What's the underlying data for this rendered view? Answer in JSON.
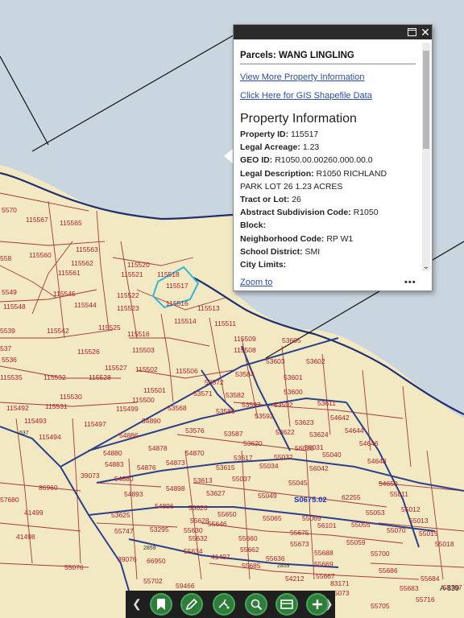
{
  "popup": {
    "controls": {
      "maximize_icon": "maximize-icon",
      "close_label": "✕"
    },
    "title": "Parcels: WANG LINGLING",
    "links": {
      "view_more": "View More Property Information",
      "shapefile": "Click Here for GIS Shapefile Data"
    },
    "section_title": "Property Information",
    "fields": [
      {
        "label": "Property ID:",
        "value": "115517"
      },
      {
        "label": "Legal Acreage:",
        "value": "1.23"
      },
      {
        "label": "GEO ID:",
        "value": "R1050.00.00260.000.00.0"
      },
      {
        "label": "Legal Description:",
        "value": "R1050 RICHLAND"
      },
      {
        "label": "",
        "value": "PARK LOT 26 1.23 ACRES"
      },
      {
        "label": "Tract or Lot:",
        "value": "26"
      },
      {
        "label": "Abstract Subdivision Code:",
        "value": "R1050"
      },
      {
        "label": "Block:",
        "value": ""
      },
      {
        "label": "Neighborhood Code:",
        "value": "RP W1"
      },
      {
        "label": "School District:",
        "value": "SMI"
      },
      {
        "label": "City Limits:",
        "value": ""
      }
    ],
    "footer": {
      "zoom": "Zoom to",
      "more": "•••"
    }
  },
  "map": {
    "colors": {
      "land": "#f2e9c3",
      "water": "#c9d6e0",
      "boundary": "#1f2f6e",
      "parcel_line": "#a5383a",
      "label": "#b0202a",
      "selected": "#2fb6d8",
      "road": "#2c3f8a"
    },
    "road_labels": [
      "637",
      "2859",
      "2859",
      "A-839"
    ],
    "highlight_label": "S0675.02",
    "parcel_labels": [
      {
        "t": "115567"
      },
      {
        "t": "115565"
      },
      {
        "t": "5570"
      },
      {
        "t": "115563"
      },
      {
        "t": "558"
      },
      {
        "t": "115560"
      },
      {
        "t": "115562"
      },
      {
        "t": "115561"
      },
      {
        "t": "115520"
      },
      {
        "t": "115521"
      },
      {
        "t": "115518"
      },
      {
        "t": "115522"
      },
      {
        "t": "115517"
      },
      {
        "t": "5549"
      },
      {
        "t": "115545"
      },
      {
        "t": "115548"
      },
      {
        "t": "115544"
      },
      {
        "t": "115523"
      },
      {
        "t": "115516"
      },
      {
        "t": "115513"
      },
      {
        "t": "115514"
      },
      {
        "t": "115511"
      },
      {
        "t": "5539"
      },
      {
        "t": "115542"
      },
      {
        "t": "115525"
      },
      {
        "t": "115516"
      },
      {
        "t": "537"
      },
      {
        "t": "115526"
      },
      {
        "t": "115503"
      },
      {
        "t": "115509"
      },
      {
        "t": "115508"
      },
      {
        "t": "53605"
      },
      {
        "t": "5536"
      },
      {
        "t": "115527"
      },
      {
        "t": "115502"
      },
      {
        "t": "115506"
      },
      {
        "t": "53584"
      },
      {
        "t": "53603"
      },
      {
        "t": "53602"
      },
      {
        "t": "115535"
      },
      {
        "t": "115532"
      },
      {
        "t": "115528"
      },
      {
        "t": "53572"
      },
      {
        "t": "53601"
      },
      {
        "t": "115501"
      },
      {
        "t": "53571"
      },
      {
        "t": "53582"
      },
      {
        "t": "53600"
      },
      {
        "t": "115530"
      },
      {
        "t": "115500"
      },
      {
        "t": "53597"
      },
      {
        "t": "115492"
      },
      {
        "t": "115531"
      },
      {
        "t": "115499"
      },
      {
        "t": "53568"
      },
      {
        "t": "53592"
      },
      {
        "t": "53611"
      },
      {
        "t": "115493"
      },
      {
        "t": "115497"
      },
      {
        "t": "54890"
      },
      {
        "t": "53586"
      },
      {
        "t": "53592"
      },
      {
        "t": "53623"
      },
      {
        "t": "54642"
      },
      {
        "t": "115494"
      },
      {
        "t": "53576"
      },
      {
        "t": "53587"
      },
      {
        "t": "53622"
      },
      {
        "t": "54644"
      },
      {
        "t": "54886"
      },
      {
        "t": "53620"
      },
      {
        "t": "56030"
      },
      {
        "t": "53624"
      },
      {
        "t": "54646"
      },
      {
        "t": "54878"
      },
      {
        "t": "53617"
      },
      {
        "t": "56031"
      },
      {
        "t": "54880"
      },
      {
        "t": "54870"
      },
      {
        "t": "55032"
      },
      {
        "t": "55040"
      },
      {
        "t": "54648"
      },
      {
        "t": "54883"
      },
      {
        "t": "54876"
      },
      {
        "t": "54873"
      },
      {
        "t": "53615"
      },
      {
        "t": "55034"
      },
      {
        "t": "56042"
      },
      {
        "t": "39073"
      },
      {
        "t": "54880"
      },
      {
        "t": "53613"
      },
      {
        "t": "55037"
      },
      {
        "t": "55045"
      },
      {
        "t": "54650"
      },
      {
        "t": "86960"
      },
      {
        "t": "54893"
      },
      {
        "t": "54898"
      },
      {
        "t": "53627"
      },
      {
        "t": "55049"
      },
      {
        "t": "62255"
      },
      {
        "t": "55011"
      },
      {
        "t": "57680"
      },
      {
        "t": "54896"
      },
      {
        "t": "55626"
      },
      {
        "t": "55065"
      },
      {
        "t": "55069"
      },
      {
        "t": "55012"
      },
      {
        "t": "41499"
      },
      {
        "t": "53625"
      },
      {
        "t": "55628"
      },
      {
        "t": "55650"
      },
      {
        "t": "55053"
      },
      {
        "t": "55013"
      },
      {
        "t": "55646"
      },
      {
        "t": "56101"
      },
      {
        "t": "55055"
      },
      {
        "t": "55070"
      },
      {
        "t": "55015"
      },
      {
        "t": "55747"
      },
      {
        "t": "53295"
      },
      {
        "t": "55630"
      },
      {
        "t": "55660"
      },
      {
        "t": "55675"
      },
      {
        "t": "41498"
      },
      {
        "t": "55632"
      },
      {
        "t": "55662"
      },
      {
        "t": "55673"
      },
      {
        "t": "55059"
      },
      {
        "t": "55018"
      },
      {
        "t": "39076"
      },
      {
        "t": "66950"
      },
      {
        "t": "55634"
      },
      {
        "t": "55688"
      },
      {
        "t": "55700"
      },
      {
        "t": "55076"
      },
      {
        "t": "41497"
      },
      {
        "t": "55636"
      },
      {
        "t": "55669"
      },
      {
        "t": "55685"
      },
      {
        "t": "55667"
      },
      {
        "t": "55686"
      },
      {
        "t": "55702"
      },
      {
        "t": "59466"
      },
      {
        "t": "54212"
      },
      {
        "t": "83171"
      },
      {
        "t": "55684"
      },
      {
        "t": "55073"
      },
      {
        "t": "55683"
      },
      {
        "t": "55705"
      },
      {
        "t": "55716"
      },
      {
        "t": "55707"
      },
      {
        "t": "55708"
      }
    ]
  },
  "toolbar": {
    "prev_label": "❮",
    "next_label": "❯",
    "tools": [
      {
        "icon": "bookmark-icon"
      },
      {
        "icon": "draw-pencil-icon"
      },
      {
        "icon": "measure-icon"
      },
      {
        "icon": "zoom-search-icon"
      },
      {
        "icon": "table-icon"
      },
      {
        "icon": "add-icon"
      }
    ]
  }
}
